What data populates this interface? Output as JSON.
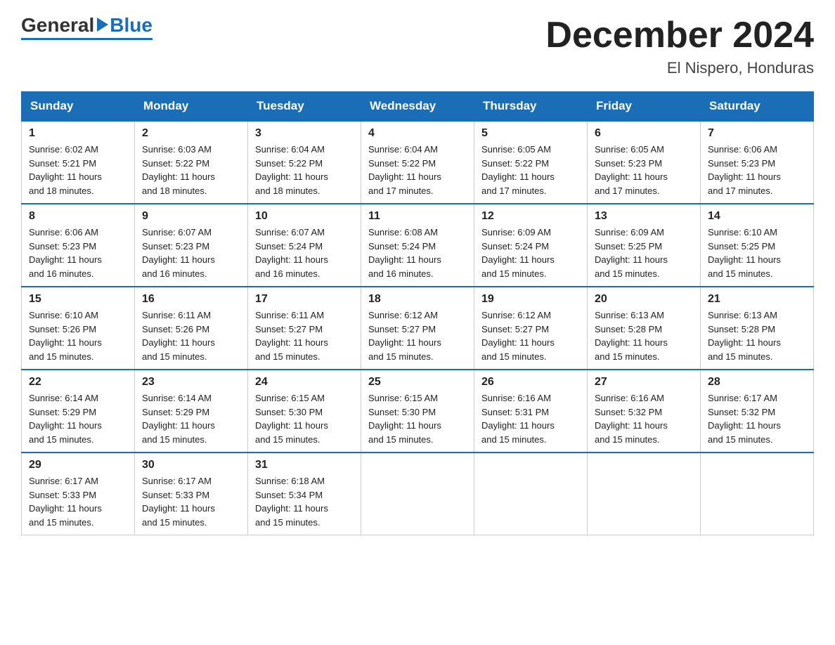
{
  "logo": {
    "general": "General",
    "blue": "Blue"
  },
  "title": "December 2024",
  "location": "El Nispero, Honduras",
  "days_of_week": [
    "Sunday",
    "Monday",
    "Tuesday",
    "Wednesday",
    "Thursday",
    "Friday",
    "Saturday"
  ],
  "weeks": [
    [
      {
        "day": "1",
        "sunrise": "6:02 AM",
        "sunset": "5:21 PM",
        "daylight": "11 hours and 18 minutes."
      },
      {
        "day": "2",
        "sunrise": "6:03 AM",
        "sunset": "5:22 PM",
        "daylight": "11 hours and 18 minutes."
      },
      {
        "day": "3",
        "sunrise": "6:04 AM",
        "sunset": "5:22 PM",
        "daylight": "11 hours and 18 minutes."
      },
      {
        "day": "4",
        "sunrise": "6:04 AM",
        "sunset": "5:22 PM",
        "daylight": "11 hours and 17 minutes."
      },
      {
        "day": "5",
        "sunrise": "6:05 AM",
        "sunset": "5:22 PM",
        "daylight": "11 hours and 17 minutes."
      },
      {
        "day": "6",
        "sunrise": "6:05 AM",
        "sunset": "5:23 PM",
        "daylight": "11 hours and 17 minutes."
      },
      {
        "day": "7",
        "sunrise": "6:06 AM",
        "sunset": "5:23 PM",
        "daylight": "11 hours and 17 minutes."
      }
    ],
    [
      {
        "day": "8",
        "sunrise": "6:06 AM",
        "sunset": "5:23 PM",
        "daylight": "11 hours and 16 minutes."
      },
      {
        "day": "9",
        "sunrise": "6:07 AM",
        "sunset": "5:23 PM",
        "daylight": "11 hours and 16 minutes."
      },
      {
        "day": "10",
        "sunrise": "6:07 AM",
        "sunset": "5:24 PM",
        "daylight": "11 hours and 16 minutes."
      },
      {
        "day": "11",
        "sunrise": "6:08 AM",
        "sunset": "5:24 PM",
        "daylight": "11 hours and 16 minutes."
      },
      {
        "day": "12",
        "sunrise": "6:09 AM",
        "sunset": "5:24 PM",
        "daylight": "11 hours and 15 minutes."
      },
      {
        "day": "13",
        "sunrise": "6:09 AM",
        "sunset": "5:25 PM",
        "daylight": "11 hours and 15 minutes."
      },
      {
        "day": "14",
        "sunrise": "6:10 AM",
        "sunset": "5:25 PM",
        "daylight": "11 hours and 15 minutes."
      }
    ],
    [
      {
        "day": "15",
        "sunrise": "6:10 AM",
        "sunset": "5:26 PM",
        "daylight": "11 hours and 15 minutes."
      },
      {
        "day": "16",
        "sunrise": "6:11 AM",
        "sunset": "5:26 PM",
        "daylight": "11 hours and 15 minutes."
      },
      {
        "day": "17",
        "sunrise": "6:11 AM",
        "sunset": "5:27 PM",
        "daylight": "11 hours and 15 minutes."
      },
      {
        "day": "18",
        "sunrise": "6:12 AM",
        "sunset": "5:27 PM",
        "daylight": "11 hours and 15 minutes."
      },
      {
        "day": "19",
        "sunrise": "6:12 AM",
        "sunset": "5:27 PM",
        "daylight": "11 hours and 15 minutes."
      },
      {
        "day": "20",
        "sunrise": "6:13 AM",
        "sunset": "5:28 PM",
        "daylight": "11 hours and 15 minutes."
      },
      {
        "day": "21",
        "sunrise": "6:13 AM",
        "sunset": "5:28 PM",
        "daylight": "11 hours and 15 minutes."
      }
    ],
    [
      {
        "day": "22",
        "sunrise": "6:14 AM",
        "sunset": "5:29 PM",
        "daylight": "11 hours and 15 minutes."
      },
      {
        "day": "23",
        "sunrise": "6:14 AM",
        "sunset": "5:29 PM",
        "daylight": "11 hours and 15 minutes."
      },
      {
        "day": "24",
        "sunrise": "6:15 AM",
        "sunset": "5:30 PM",
        "daylight": "11 hours and 15 minutes."
      },
      {
        "day": "25",
        "sunrise": "6:15 AM",
        "sunset": "5:30 PM",
        "daylight": "11 hours and 15 minutes."
      },
      {
        "day": "26",
        "sunrise": "6:16 AM",
        "sunset": "5:31 PM",
        "daylight": "11 hours and 15 minutes."
      },
      {
        "day": "27",
        "sunrise": "6:16 AM",
        "sunset": "5:32 PM",
        "daylight": "11 hours and 15 minutes."
      },
      {
        "day": "28",
        "sunrise": "6:17 AM",
        "sunset": "5:32 PM",
        "daylight": "11 hours and 15 minutes."
      }
    ],
    [
      {
        "day": "29",
        "sunrise": "6:17 AM",
        "sunset": "5:33 PM",
        "daylight": "11 hours and 15 minutes."
      },
      {
        "day": "30",
        "sunrise": "6:17 AM",
        "sunset": "5:33 PM",
        "daylight": "11 hours and 15 minutes."
      },
      {
        "day": "31",
        "sunrise": "6:18 AM",
        "sunset": "5:34 PM",
        "daylight": "11 hours and 15 minutes."
      },
      null,
      null,
      null,
      null
    ]
  ],
  "labels": {
    "sunrise": "Sunrise:",
    "sunset": "Sunset:",
    "daylight": "Daylight:"
  }
}
